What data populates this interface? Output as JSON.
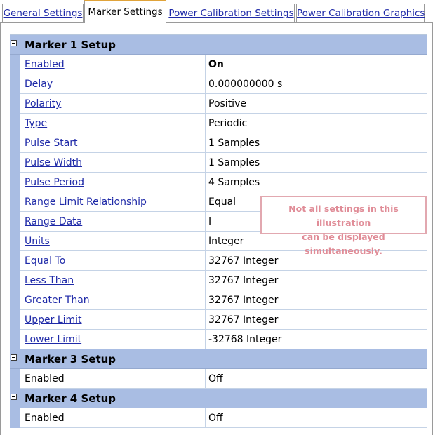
{
  "tabs": [
    {
      "label": "General Settings",
      "active": false
    },
    {
      "label": "Marker Settings",
      "active": true
    },
    {
      "label": "Power Calibration Settings",
      "active": false
    },
    {
      "label": "Power Calibration Graphics",
      "active": false
    }
  ],
  "marker1": {
    "title": "Marker 1 Setup",
    "rows": [
      {
        "name": "Enabled",
        "value": "On"
      },
      {
        "name": "Delay",
        "value": "0.000000000 s"
      },
      {
        "name": "Polarity",
        "value": "Positive"
      },
      {
        "name": "Type",
        "value": "Periodic"
      },
      {
        "name": "Pulse Start",
        "value": "1 Samples"
      },
      {
        "name": "Pulse Width",
        "value": "1 Samples"
      },
      {
        "name": "Pulse Period",
        "value": "4 Samples"
      },
      {
        "name": "Range Limit Relationship",
        "value": "Equal"
      },
      {
        "name": "Range Data",
        "value": "I"
      },
      {
        "name": "Units",
        "value": "Integer"
      },
      {
        "name": "Equal To",
        "value": "32767 Integer"
      },
      {
        "name": "Less Than",
        "value": "32767 Integer"
      },
      {
        "name": "Greater Than",
        "value": "32767 Integer"
      },
      {
        "name": "Upper Limit",
        "value": "32767 Integer"
      },
      {
        "name": "Lower Limit",
        "value": "-32768 Integer"
      }
    ]
  },
  "marker3": {
    "title": "Marker 3 Setup",
    "rows": [
      {
        "name": "Enabled",
        "value": "Off"
      }
    ]
  },
  "marker4": {
    "title": "Marker 4 Setup",
    "rows": [
      {
        "name": "Enabled",
        "value": "Off"
      }
    ]
  },
  "note": {
    "line1": "Not all settings in this illustration",
    "line2": "can be displayed simultaneously."
  },
  "colors": {
    "category_band": "#a9bde3",
    "link": "#1f2aa8",
    "note": "#e08c97",
    "active_tab_accent": "#e0a33a"
  }
}
